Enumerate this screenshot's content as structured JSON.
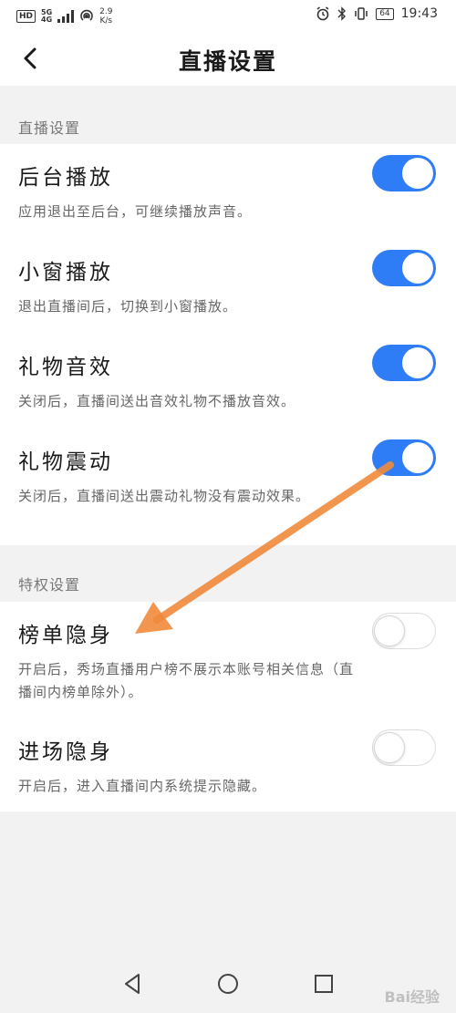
{
  "status_bar": {
    "hd_badge": "HD",
    "net_type": "5G",
    "net_sub": "4G",
    "speed_value": "2.9",
    "speed_unit": "K/s",
    "battery": "64",
    "time": "19:43"
  },
  "header": {
    "title": "直播设置"
  },
  "sections": [
    {
      "label": "直播设置",
      "items": [
        {
          "title": "后台播放",
          "desc": "应用退出至后台，可继续播放声音。",
          "enabled": true
        },
        {
          "title": "小窗播放",
          "desc": "退出直播间后，切换到小窗播放。",
          "enabled": true
        },
        {
          "title": "礼物音效",
          "desc": "关闭后，直播间送出音效礼物不播放音效。",
          "enabled": true
        },
        {
          "title": "礼物震动",
          "desc": "关闭后，直播间送出震动礼物没有震动效果。",
          "enabled": true
        }
      ]
    },
    {
      "label": "特权设置",
      "items": [
        {
          "title": "榜单隐身",
          "desc": "开启后，秀场直播用户榜不展示本账号相关信息（直播间内榜单除外）。",
          "enabled": false
        },
        {
          "title": "进场隐身",
          "desc": "开启后，进入直播间内系统提示隐藏。",
          "enabled": false
        }
      ]
    }
  ],
  "colors": {
    "toggle_on": "#2f7df6",
    "arrow": "#f08a3c"
  },
  "watermark": "Bai经验"
}
